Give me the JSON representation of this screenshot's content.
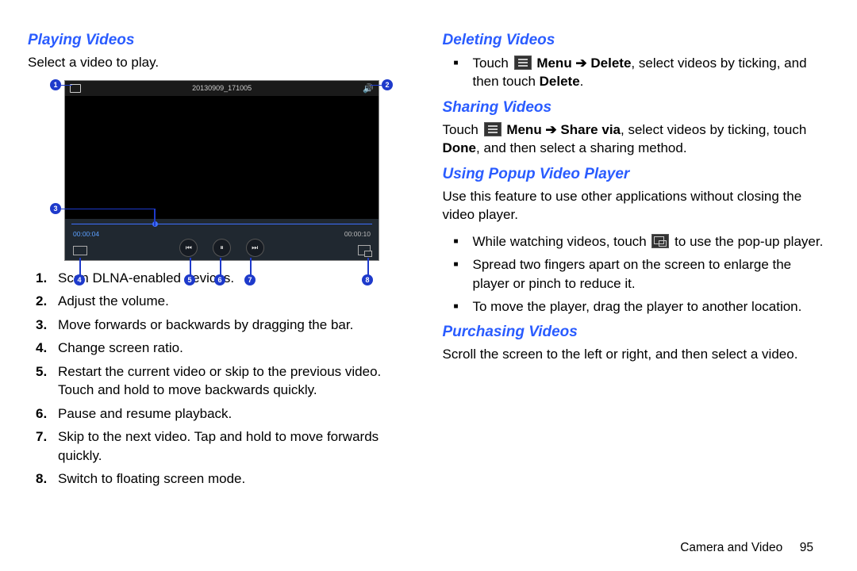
{
  "left": {
    "h_playing": "Playing Videos",
    "intro": "Select a video to play.",
    "player": {
      "title": "20130909_171005",
      "time_current": "00:00:04",
      "time_total": "00:00:10"
    },
    "annot": {
      "a1": "1",
      "a2": "2",
      "a3": "3",
      "a4": "4",
      "a5": "5",
      "a6": "6",
      "a7": "7",
      "a8": "8"
    },
    "items": [
      "Scan DLNA-enabled devices.",
      "Adjust the volume.",
      "Move forwards or backwards by dragging the bar.",
      "Change screen ratio.",
      "Restart the current video or skip to the previous video. Touch and hold to move backwards quickly.",
      "Pause and resume playback.",
      "Skip to the next video. Tap and hold to move forwards quickly.",
      "Switch to floating screen mode."
    ]
  },
  "right": {
    "h_deleting": "Deleting Videos",
    "deleting_pre": "Touch ",
    "deleting_mid1": " Menu ➔ Delete",
    "deleting_post": ", select videos by ticking, and then touch ",
    "deleting_end": "Delete",
    "deleting_period": ".",
    "h_sharing": "Sharing Videos",
    "sharing_pre": "Touch ",
    "sharing_mid1": " Menu ➔ Share via",
    "sharing_post": ", select videos by ticking, touch ",
    "sharing_done": "Done",
    "sharing_end": ", and then select a sharing method.",
    "h_popup": "Using Popup Video Player",
    "popup_intro": "Use this feature to use other applications without closing the video player.",
    "popup_b1_pre": "While watching videos, touch ",
    "popup_b1_post": " to use the pop-up player.",
    "popup_b2": "Spread two fingers apart on the screen to enlarge the player or pinch to reduce it.",
    "popup_b3": "To move the player, drag the player to another location.",
    "h_purchasing": "Purchasing Videos",
    "purchasing_text": "Scroll the screen to the left or right, and then select a video."
  },
  "footer": {
    "section": "Camera and Video",
    "page": "95"
  }
}
